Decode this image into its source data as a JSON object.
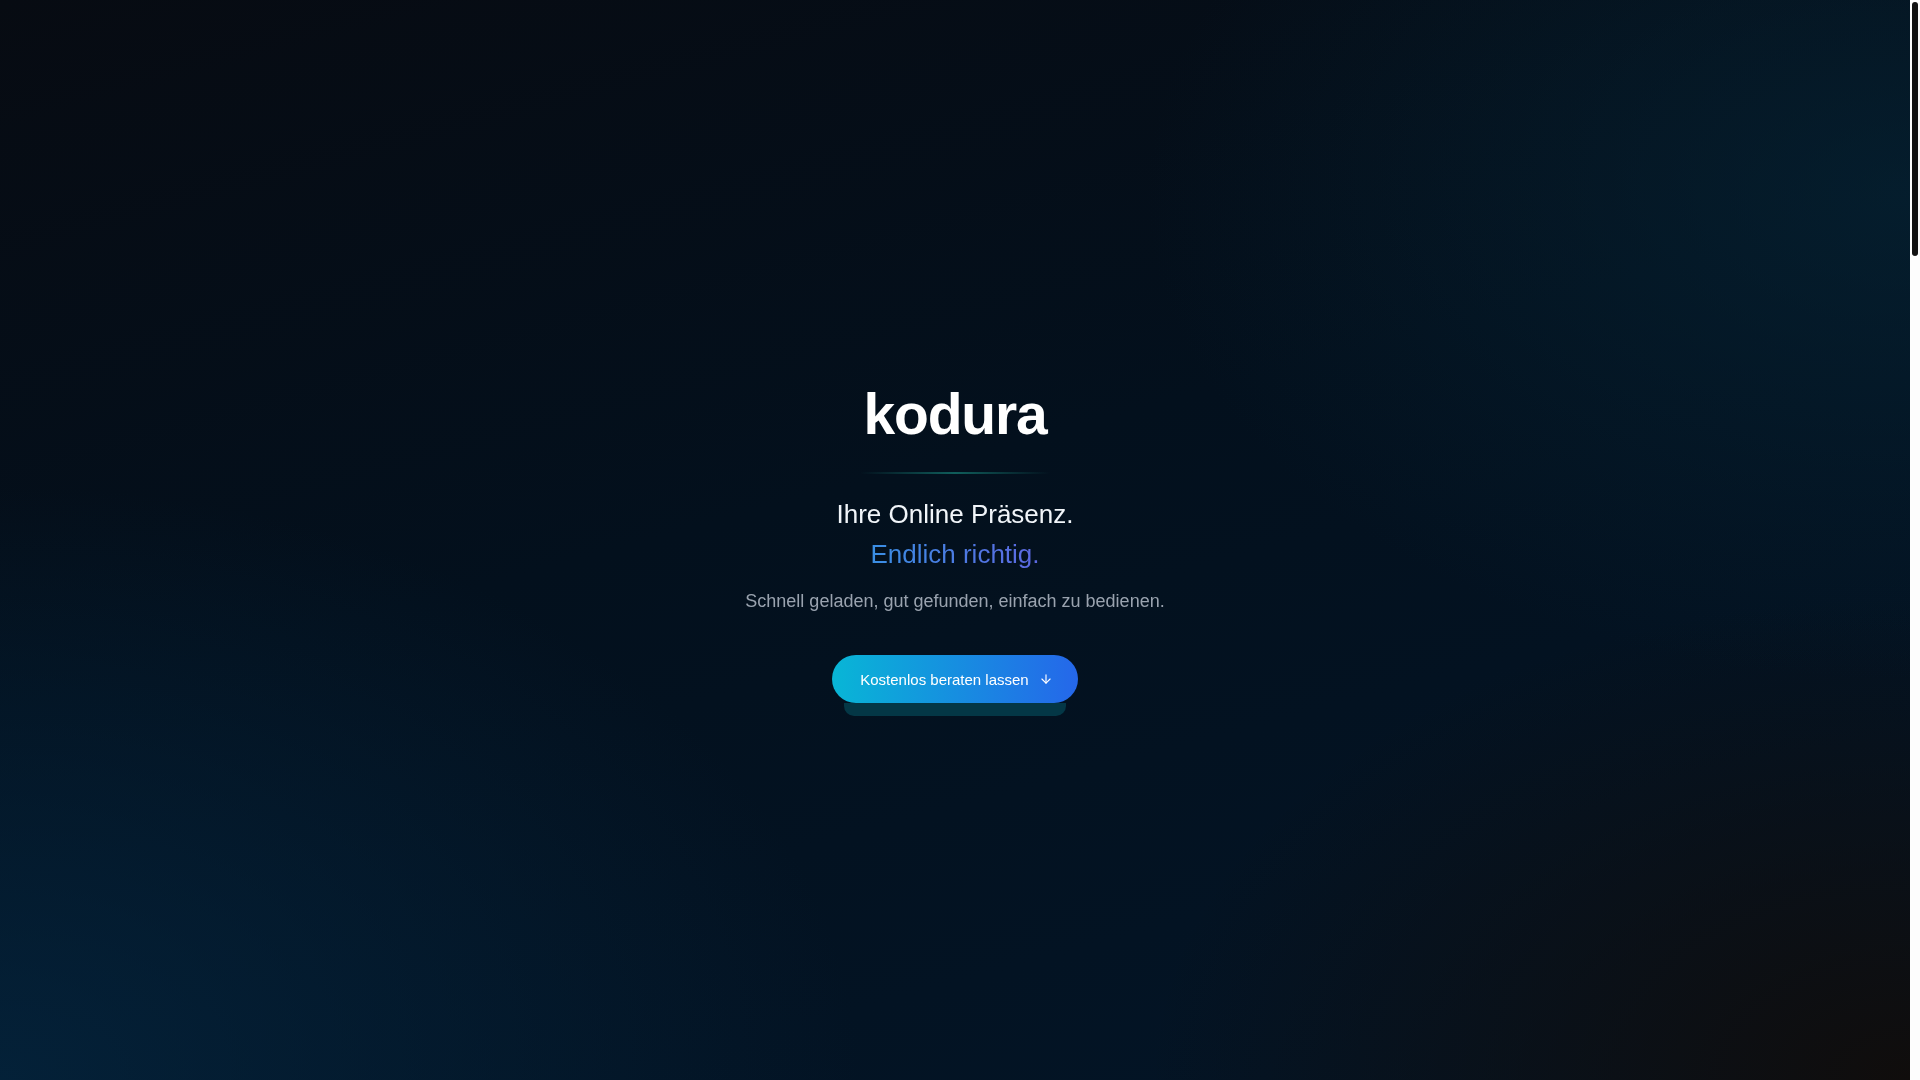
{
  "brand": {
    "logo": "kodura"
  },
  "hero": {
    "headline": "Ihre Online Präsenz.",
    "highlight": "Endlich richtig.",
    "subtitle": "Schnell geladen, gut gefunden, einfach zu bedienen.",
    "cta": {
      "label": "Kostenlos beraten lassen"
    }
  }
}
